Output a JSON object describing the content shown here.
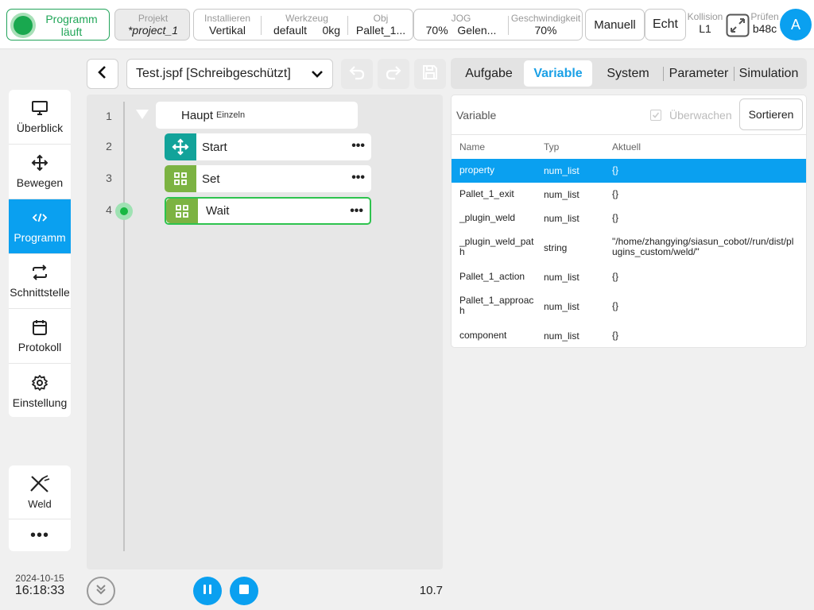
{
  "topbar": {
    "status": "Programm läuft",
    "project": {
      "label": "Projekt",
      "value": "*project_1"
    },
    "install": {
      "label": "Installieren",
      "value": "Vertikal"
    },
    "tool": {
      "label": "Werkzeug",
      "value": "default",
      "payload": "0kg"
    },
    "obj": {
      "label": "Obj",
      "value": "Pallet_1..."
    },
    "jog": {
      "label": "JOG",
      "value": "70%",
      "mode": "Gelen..."
    },
    "speed": {
      "label": "Geschwindigkeit",
      "value": "70%"
    },
    "manual_label": "Manuell",
    "real_label": "Echt",
    "collision": {
      "label": "Kollision",
      "value": "L1"
    },
    "check": {
      "label": "Prüfen",
      "value": "b48c"
    },
    "avatar": "A",
    "status_color": "#21a658",
    "accent": "#0aa0f0"
  },
  "sidebar": {
    "items": [
      {
        "label": "Überblick",
        "icon": "monitor-icon"
      },
      {
        "label": "Bewegen",
        "icon": "move-icon"
      },
      {
        "label": "Programm",
        "icon": "code-icon"
      },
      {
        "label": "Schnittstelle",
        "icon": "exchange-icon"
      },
      {
        "label": "Protokoll",
        "icon": "calendar-icon"
      },
      {
        "label": "Einstellung",
        "icon": "gear-icon"
      }
    ],
    "weld_label": "Weld",
    "more_label": "•••",
    "date": "2024-10-15",
    "time": "16:18:33"
  },
  "editor": {
    "file": "Test.jspf [Schreibgeschützt]",
    "line_numbers": [
      "1",
      "2",
      "3",
      "4"
    ],
    "root": {
      "label": "Haupt",
      "sub": "Einzeln"
    },
    "nodes": [
      {
        "label": "Start",
        "icon": "move-icon",
        "color": "#12a39a"
      },
      {
        "label": "Set",
        "icon": "grid-icon",
        "color": "#7cb342"
      },
      {
        "label": "Wait",
        "icon": "grid-icon",
        "color": "#7cb342"
      }
    ],
    "version": "10.7"
  },
  "tabs": [
    "Aufgabe",
    "Variable",
    "System",
    "Parameter",
    "Simulation"
  ],
  "variables": {
    "title": "Variable",
    "monitor_label": "Überwachen",
    "sort_label": "Sortieren",
    "headers": [
      "Name",
      "Typ",
      "Aktuell"
    ],
    "rows": [
      {
        "name": "property",
        "type": "num_list",
        "value": "{}"
      },
      {
        "name": "Pallet_1_exit",
        "type": "num_list",
        "value": "{}"
      },
      {
        "name": "_plugin_weld",
        "type": "num_list",
        "value": "{}"
      },
      {
        "name": "_plugin_weld_path",
        "type": "string",
        "value": "\"/home/zhangying/siasun_cobot//run/dist/plugins_custom/weld/\""
      },
      {
        "name": "Pallet_1_action",
        "type": "num_list",
        "value": "{}"
      },
      {
        "name": "Pallet_1_approach",
        "type": "num_list",
        "value": "{}"
      },
      {
        "name": "component",
        "type": "num_list",
        "value": "{}"
      }
    ]
  }
}
